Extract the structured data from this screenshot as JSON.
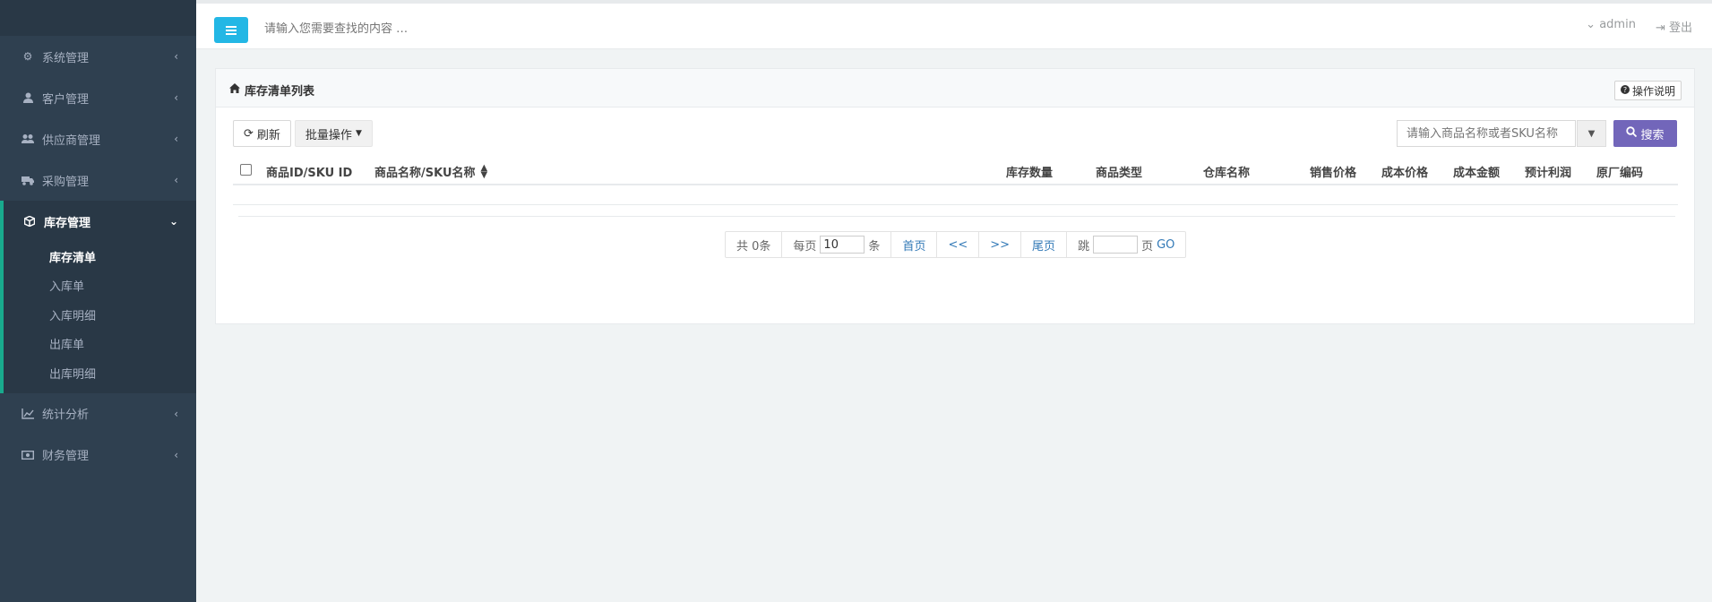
{
  "sidebar": {
    "items": [
      {
        "label": "系统管理",
        "icon": "cogs-icon"
      },
      {
        "label": "客户管理",
        "icon": "user-icon"
      },
      {
        "label": "供应商管理",
        "icon": "users-icon"
      },
      {
        "label": "采购管理",
        "icon": "truck-icon"
      }
    ],
    "active": {
      "label": "库存管理",
      "icon": "cube-icon",
      "children": [
        "库存清单",
        "入库单",
        "入库明细",
        "出库单",
        "出库明细"
      ]
    },
    "bottom_items": [
      {
        "label": "统计分析",
        "icon": "line-chart-icon"
      },
      {
        "label": "财务管理",
        "icon": "money-icon"
      }
    ]
  },
  "topbar": {
    "search_placeholder": "请输入您需要查找的内容 …",
    "user": "admin",
    "logout": "登出"
  },
  "panel": {
    "title": "库存清单列表",
    "help": "操作说明",
    "refresh": "刷新",
    "batch": "批量操作",
    "search_placeholder": "请输入商品名称或者SKU名称",
    "search_btn": "搜索"
  },
  "table": {
    "columns": [
      "商品ID/SKU ID",
      "商品名称/SKU名称",
      "库存数量",
      "商品类型",
      "仓库名称",
      "销售价格",
      "成本价格",
      "成本金额",
      "预计利润",
      "原厂编码"
    ]
  },
  "pager": {
    "total": "共 0条",
    "per_page_label": "每页",
    "per_page_value": "10",
    "per_page_unit": "条",
    "first": "首页",
    "prev": "<<",
    "next": ">>",
    "last": "尾页",
    "jump_label": "跳",
    "page_unit": "页",
    "go": "GO"
  },
  "colors": {
    "sidebar": "#2f4050",
    "accent": "#23b7e5",
    "search_btn": "#7266ba"
  }
}
